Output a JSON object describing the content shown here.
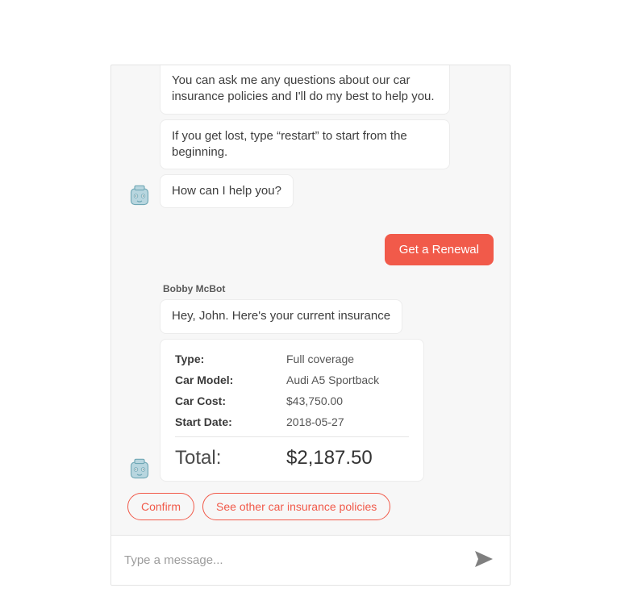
{
  "bot": {
    "name": "Bobby McBot",
    "intro": [
      "You can ask me any questions about our car insurance policies and I'll do my best to help you.",
      "If you get lost, type “restart” to start from the beginning.",
      "How can I help you?"
    ],
    "reply": "Hey, John. Here's your current insurance"
  },
  "user": {
    "message": "Get a Renewal"
  },
  "card": {
    "rows": [
      {
        "label": "Type:",
        "value": "Full coverage"
      },
      {
        "label": "Car Model:",
        "value": "Audi A5 Sportback"
      },
      {
        "label": "Car Cost:",
        "value": "$43,750.00"
      },
      {
        "label": "Start Date:",
        "value": "2018-05-27"
      }
    ],
    "total_label": "Total:",
    "total_value": "$2,187.50"
  },
  "actions": {
    "confirm": "Confirm",
    "see_other": "See other car insurance policies"
  },
  "input": {
    "placeholder": "Type a message..."
  },
  "colors": {
    "accent": "#f15a4a"
  }
}
